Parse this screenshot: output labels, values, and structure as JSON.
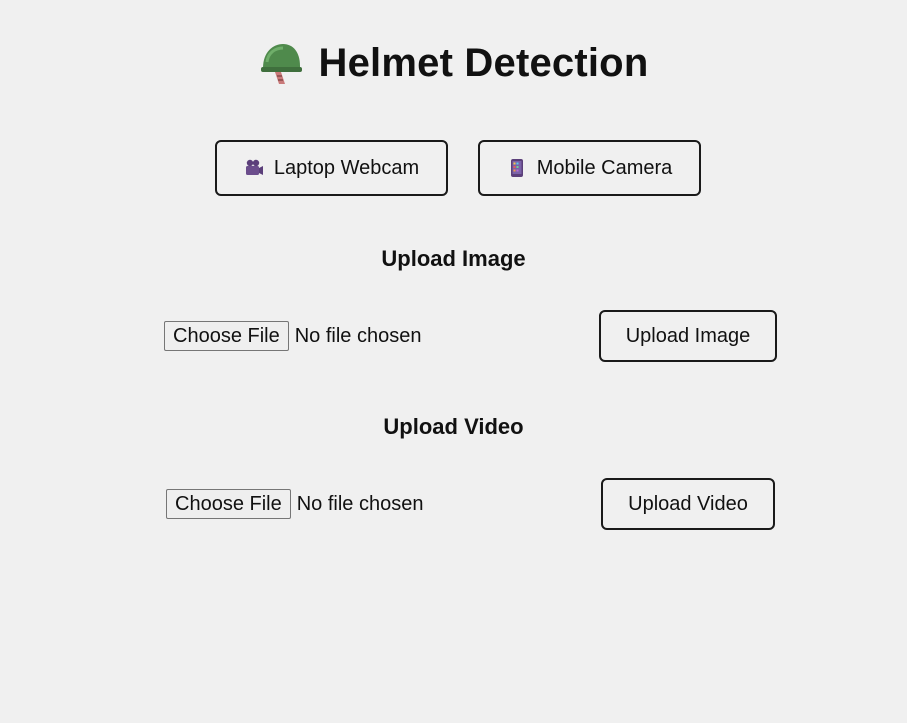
{
  "header": {
    "title": "Helmet Detection",
    "icon": "helmet-icon"
  },
  "camera_buttons": {
    "webcam_label": "Laptop Webcam",
    "webcam_icon": "video-camera-icon",
    "mobile_label": "Mobile Camera",
    "mobile_icon": "mobile-phone-icon"
  },
  "image_upload": {
    "heading": "Upload Image",
    "choose_label": "Choose File",
    "file_status": "No file chosen",
    "submit_label": "Upload Image"
  },
  "video_upload": {
    "heading": "Upload Video",
    "choose_label": "Choose File",
    "file_status": "No file chosen",
    "submit_label": "Upload Video"
  },
  "colors": {
    "background": "#f0f0f0",
    "helmet_green": "#4f8a4c",
    "button_border": "#1a1a1a"
  }
}
